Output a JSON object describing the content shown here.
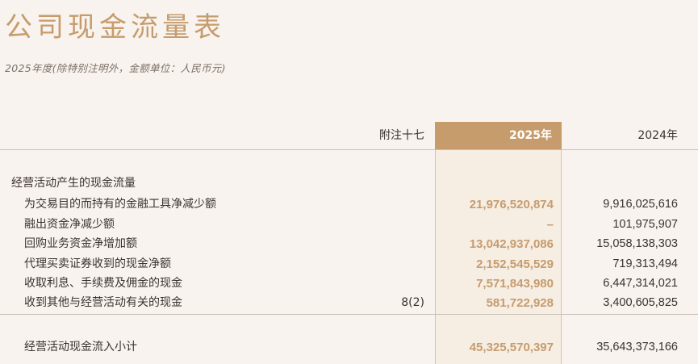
{
  "title": "公司现金流量表",
  "subtitle": "2025年度(除特别注明外，金额单位：人民币元)",
  "columns": {
    "note": "附注十七",
    "current_year": "2025年",
    "prior_year": "2024年"
  },
  "section_heading": "经营活动产生的现金流量",
  "rows": [
    {
      "label": "为交易目的而持有的金融工具净减少额",
      "note": "",
      "current": "21,976,520,874",
      "prior": "9,916,025,616"
    },
    {
      "label": "融出资金净减少额",
      "note": "",
      "current": "–",
      "prior": "101,975,907"
    },
    {
      "label": "回购业务资金净增加额",
      "note": "",
      "current": "13,042,937,086",
      "prior": "15,058,138,303"
    },
    {
      "label": "代理买卖证券收到的现金净额",
      "note": "",
      "current": "2,152,545,529",
      "prior": "719,313,494"
    },
    {
      "label": "收取利息、手续费及佣金的现金",
      "note": "",
      "current": "7,571,843,980",
      "prior": "6,447,314,021"
    },
    {
      "label": "收到其他与经营活动有关的现金",
      "note": "8(2)",
      "current": "581,722,928",
      "prior": "3,400,605,825"
    }
  ],
  "subtotal": {
    "label": "经营活动现金流入小计",
    "current": "45,325,570,397",
    "prior": "35,643,373,166"
  },
  "colors": {
    "accent": "#c69c6d",
    "background": "#f8f3ee",
    "highlight_column": "#f6ede3",
    "text": "#3b3330"
  }
}
